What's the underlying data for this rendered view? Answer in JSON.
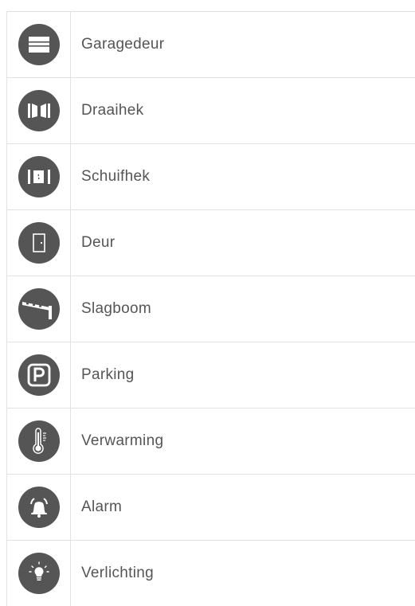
{
  "items": [
    {
      "label": "Garagedeur",
      "icon": "garage-door-icon"
    },
    {
      "label": "Draaihek",
      "icon": "swing-gate-icon"
    },
    {
      "label": "Schuifhek",
      "icon": "sliding-gate-icon"
    },
    {
      "label": "Deur",
      "icon": "door-icon"
    },
    {
      "label": "Slagboom",
      "icon": "barrier-icon"
    },
    {
      "label": "Parking",
      "icon": "parking-icon"
    },
    {
      "label": "Verwarming",
      "icon": "thermometer-icon"
    },
    {
      "label": "Alarm",
      "icon": "alarm-bell-icon"
    },
    {
      "label": "Verlichting",
      "icon": "lightbulb-icon"
    }
  ],
  "colors": {
    "icon_bg": "#555555",
    "icon_fg": "#ffffff",
    "text": "#555555",
    "divider": "#e2e2e2"
  }
}
